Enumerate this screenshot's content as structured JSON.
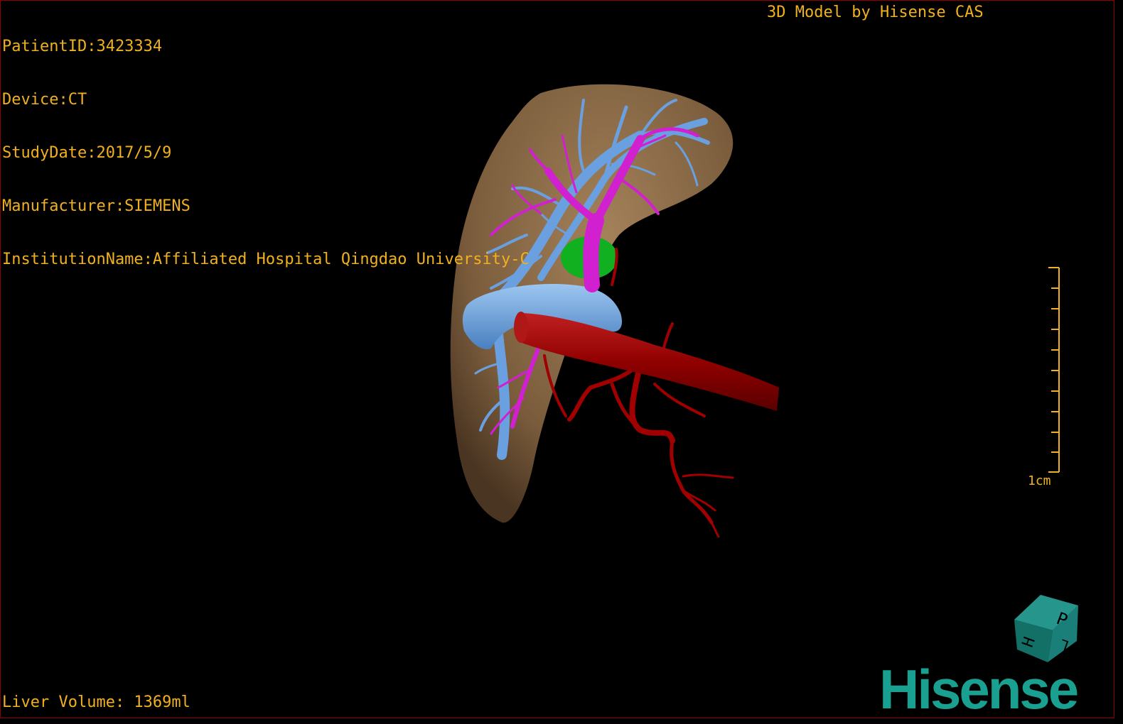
{
  "overlay": {
    "patient_id": "PatientID:3423334",
    "device": "Device:CT",
    "study_date": "StudyDate:2017/5/9",
    "manufacturer": "Manufacturer:SIEMENS",
    "institution": "InstitutionName:Affiliated Hospital Qingdao University-C",
    "model_credit": "3D Model by Hisense CAS",
    "liver_volume": "Liver Volume: 1369ml"
  },
  "scale": {
    "label": "1cm",
    "ticks": 10
  },
  "orientation_cube": {
    "faces": [
      "P",
      "H",
      "L"
    ],
    "color": "#1a7f78"
  },
  "logo": {
    "text": "Hisense",
    "color": "#1aa090"
  },
  "colors": {
    "liver": "#8a6a48",
    "hepatic_vein": "#6aa0e0",
    "portal_vein": "#d020d0",
    "artery": "#a00000",
    "lesion": "#10c020",
    "overlay_text": "#f0b020"
  }
}
